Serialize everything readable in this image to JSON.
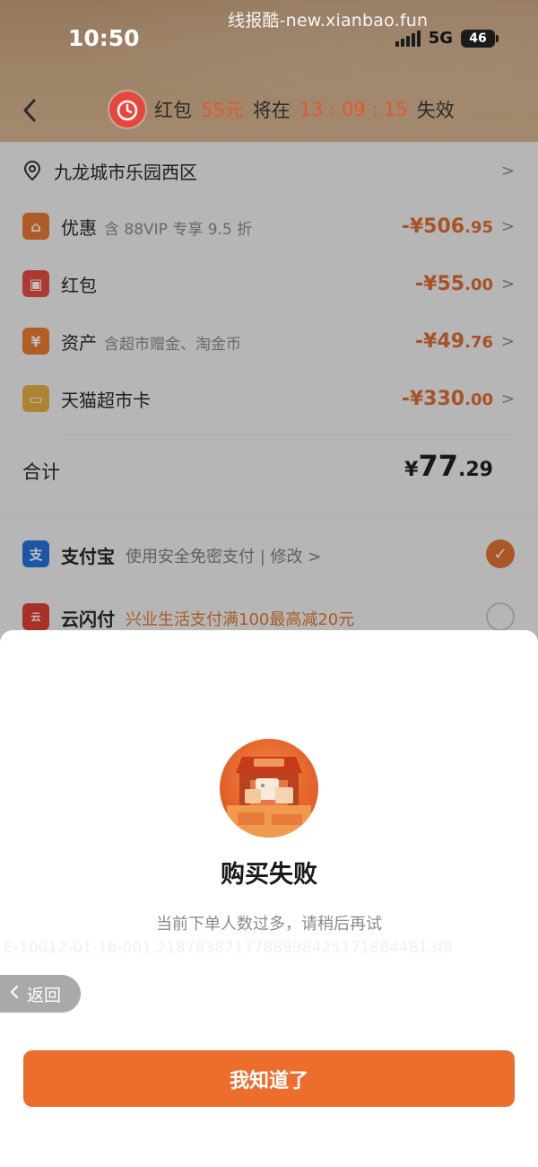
{
  "status_bar": {
    "watermark": "线报酷-new.xianbao.fun",
    "time": "10:50",
    "network": "5G",
    "battery": "46"
  },
  "header": {
    "prefix": "红包",
    "amount": "55元",
    "middle": "将在",
    "countdown": "13 : 09 : 15",
    "suffix": "失效"
  },
  "address": {
    "text": "九龙城市乐园西区"
  },
  "discounts": [
    {
      "icon": "tag-icon",
      "label": "优惠",
      "sub": "含 88VIP 专享 9.5 折",
      "amount_main": "-¥506",
      "amount_dec": ".95",
      "color": "#e8782e"
    },
    {
      "icon": "red-packet-icon",
      "label": "红包",
      "sub": "",
      "amount_main": "-¥55",
      "amount_dec": ".00",
      "color": "#e54a3c"
    },
    {
      "icon": "yuan-icon",
      "label": "资产",
      "sub": "含超市赠金、淘金币",
      "amount_main": "-¥49",
      "amount_dec": ".76",
      "color": "#ec7a2a"
    },
    {
      "icon": "card-icon",
      "label": "天猫超市卡",
      "sub": "",
      "amount_main": "-¥330",
      "amount_dec": ".00",
      "color": "#e7b13e"
    }
  ],
  "total": {
    "label": "合计",
    "yen": "¥",
    "amount_main": "77",
    "amount_dec": ".29"
  },
  "payment": {
    "alipay": {
      "name": "支付宝",
      "desc": "使用安全免密支付 | 修改 >",
      "icon_text": "支",
      "color": "#1f6fe0"
    },
    "unionpay": {
      "name": "云闪付",
      "desc": "兴业生活支付满100最高减20元",
      "icon_text": "云",
      "color": "#e23b2d"
    }
  },
  "dialog": {
    "title": "购买失败",
    "message": "当前下单人数过多，请稍后再试",
    "trace": "E-10012-01-16-001.21878387177889984251718844813f8",
    "back_label": "返回",
    "confirm_label": "我知道了"
  }
}
